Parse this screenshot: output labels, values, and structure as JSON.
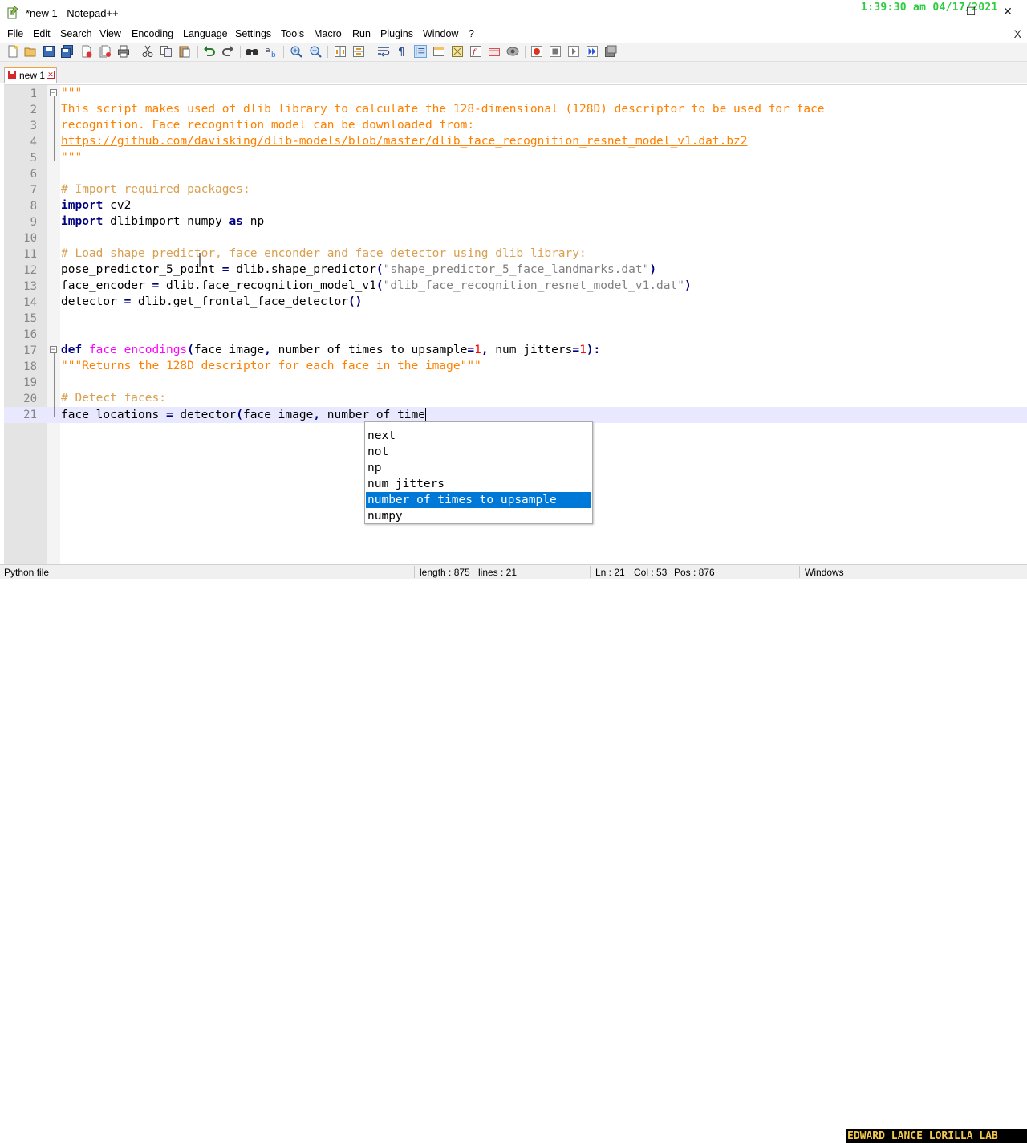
{
  "window": {
    "title": "*new 1 - Notepad++",
    "clock": "1:39:30 am 04/17/2021",
    "close_glyph": "✕",
    "maximize_glyph": "☐"
  },
  "menu": {
    "items": [
      "File",
      "Edit",
      "Search",
      "View",
      "Encoding",
      "Language",
      "Settings",
      "Tools",
      "Macro",
      "Run",
      "Plugins",
      "Window",
      "?"
    ],
    "close_glyph": "X"
  },
  "toolbar": {
    "icons": [
      "new-file-icon",
      "open-file-icon",
      "save-icon",
      "save-all-icon",
      "close-icon",
      "close-all-icon",
      "print-icon",
      "cut-icon",
      "copy-icon",
      "paste-icon",
      "undo-icon",
      "redo-icon",
      "find-icon",
      "replace-icon",
      "zoom-in-icon",
      "zoom-out-icon",
      "sync-vertical-icon",
      "sync-horizontal-icon",
      "word-wrap-icon",
      "show-all-characters-icon",
      "indent-guide-icon",
      "udl-icon",
      "doc-map-icon",
      "function-list-icon",
      "folder-as-workspace-icon",
      "monitoring-icon",
      "record-macro-icon",
      "stop-macro-icon",
      "play-macro-icon",
      "run-macro-multiple-icon",
      "save-macro-icon"
    ]
  },
  "tab": {
    "label": "new 1",
    "close_glyph": "✕"
  },
  "editor": {
    "line_numbers": [
      "1",
      "2",
      "3",
      "4",
      "5",
      "6",
      "7",
      "8",
      "9",
      "10",
      "11",
      "12",
      "13",
      "14",
      "15",
      "16",
      "17",
      "18",
      "19",
      "20",
      "21"
    ],
    "lines": [
      [
        {
          "t": "\"\"\"",
          "c": "c-str"
        }
      ],
      [
        {
          "t": "This script makes used of dlib library to calculate the 128-dimensional (128D) descriptor to be used for face",
          "c": "c-str"
        }
      ],
      [
        {
          "t": "recognition. Face recognition model can be downloaded from:",
          "c": "c-str"
        }
      ],
      [
        {
          "t": "https://github.com/davisking/dlib-models/blob/master/dlib_face_recognition_resnet_model_v1.dat.bz2",
          "c": "c-url"
        }
      ],
      [
        {
          "t": "\"\"\"",
          "c": "c-str"
        }
      ],
      [],
      [
        {
          "t": "# Import required packages:",
          "c": "c-cmt"
        }
      ],
      [
        {
          "t": "import",
          "c": "c-kw"
        },
        {
          "t": " cv2",
          "c": ""
        }
      ],
      [
        {
          "t": "import",
          "c": "c-kw"
        },
        {
          "t": " dlibimport numpy ",
          "c": ""
        },
        {
          "t": "as",
          "c": "c-kw"
        },
        {
          "t": " np",
          "c": ""
        }
      ],
      [],
      [
        {
          "t": "# Load shape predictor, face enconder and face detector using dlib library:",
          "c": "c-cmt"
        }
      ],
      [
        {
          "t": "pose_predictor_5_point ",
          "c": ""
        },
        {
          "t": "=",
          "c": "c-op"
        },
        {
          "t": " dlib.shape_predictor",
          "c": ""
        },
        {
          "t": "(",
          "c": "c-op"
        },
        {
          "t": "\"shape_predictor_5_face_landmarks.dat\"",
          "c": "c-lit"
        },
        {
          "t": ")",
          "c": "c-op"
        }
      ],
      [
        {
          "t": "face_encoder ",
          "c": ""
        },
        {
          "t": "=",
          "c": "c-op"
        },
        {
          "t": " dlib.face_recognition_model_v1",
          "c": ""
        },
        {
          "t": "(",
          "c": "c-op"
        },
        {
          "t": "\"dlib_face_recognition_resnet_model_v1.dat\"",
          "c": "c-lit"
        },
        {
          "t": ")",
          "c": "c-op"
        }
      ],
      [
        {
          "t": "detector ",
          "c": ""
        },
        {
          "t": "=",
          "c": "c-op"
        },
        {
          "t": " dlib.get_frontal_face_detector",
          "c": ""
        },
        {
          "t": "()",
          "c": "c-op"
        }
      ],
      [],
      [],
      [
        {
          "t": "def",
          "c": "c-kw"
        },
        {
          "t": " ",
          "c": ""
        },
        {
          "t": "face_encodings",
          "c": "c-fn"
        },
        {
          "t": "(",
          "c": "c-op"
        },
        {
          "t": "face_image",
          "c": ""
        },
        {
          "t": ",",
          "c": "c-op"
        },
        {
          "t": " number_of_times_to_upsample",
          "c": ""
        },
        {
          "t": "=",
          "c": "c-op"
        },
        {
          "t": "1",
          "c": "c-num"
        },
        {
          "t": ",",
          "c": "c-op"
        },
        {
          "t": " num_jitters",
          "c": ""
        },
        {
          "t": "=",
          "c": "c-op"
        },
        {
          "t": "1",
          "c": "c-num"
        },
        {
          "t": "):",
          "c": "c-op"
        }
      ],
      [
        {
          "t": "\"\"\"Returns the 128D descriptor for each face in the image\"\"\"",
          "c": "c-str"
        }
      ],
      [],
      [
        {
          "t": "# Detect faces:",
          "c": "c-cmt"
        }
      ],
      [
        {
          "t": "face_locations ",
          "c": ""
        },
        {
          "t": "=",
          "c": "c-op"
        },
        {
          "t": " detector",
          "c": ""
        },
        {
          "t": "(",
          "c": "c-op"
        },
        {
          "t": "face_image",
          "c": ""
        },
        {
          "t": ",",
          "c": "c-op"
        },
        {
          "t": " number_of_time",
          "c": ""
        }
      ]
    ],
    "fold_open_glyph": "−"
  },
  "autocomplete": {
    "items": [
      "next",
      "not",
      "np",
      "num_jitters",
      "number_of_times_to_upsample",
      "numpy"
    ],
    "selected_item": "number_of_times_to_upsample"
  },
  "status": {
    "file_type": "Python file",
    "length": "length : 875",
    "lines": "lines : 21",
    "ln": "Ln : 21",
    "col": "Col : 53",
    "pos": "Pos : 876",
    "eol": "Windows",
    "watermark": "EDWARD LANCE LORILLA LAB"
  },
  "colors": {
    "string": "#ff8000",
    "comment": "#d8a050",
    "keyword": "#000080",
    "selection": "#0078d7",
    "current_line": "#e8e8ff",
    "clock": "#2ecc40"
  }
}
